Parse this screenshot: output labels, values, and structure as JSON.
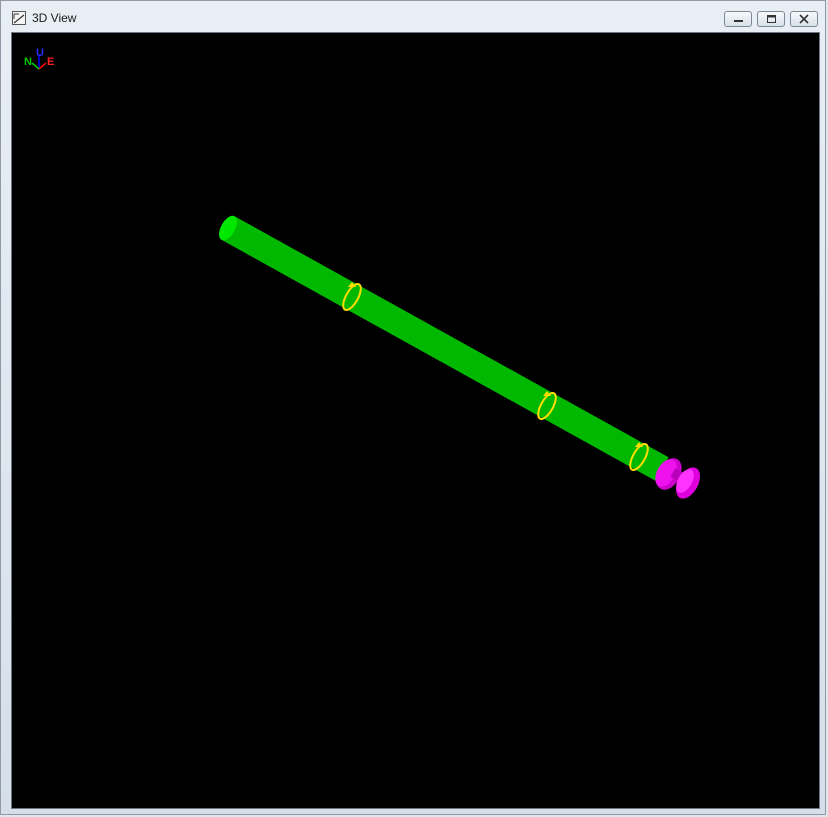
{
  "window": {
    "title": "3D View",
    "controls": {
      "minimize_icon": "minimize-icon",
      "restore_icon": "restore-icon",
      "close_icon": "close-icon"
    }
  },
  "orientation_triad": {
    "north_label": "N",
    "up_label": "U",
    "east_label": "E",
    "colors": {
      "north": "#00cc00",
      "up": "#0000ff",
      "east": "#ff0000"
    }
  },
  "scene": {
    "background_color": "#000000",
    "pipe_color": "#00ee00",
    "support_color": "#ffdd00",
    "valve_color": "#ee00ee",
    "support_count": 3
  }
}
